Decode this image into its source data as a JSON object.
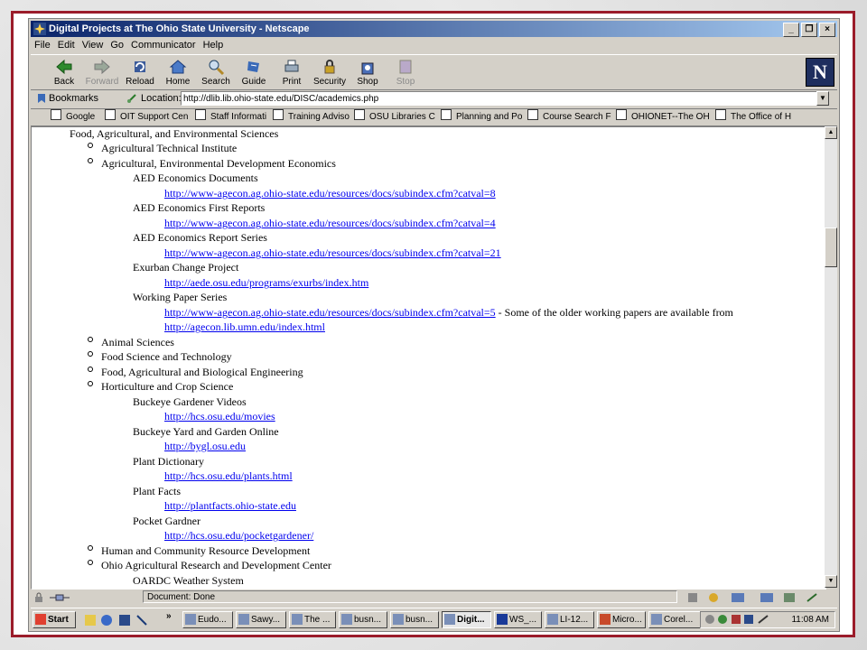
{
  "window": {
    "title": "Digital Projects at The Ohio State University - Netscape"
  },
  "menu": [
    "File",
    "Edit",
    "View",
    "Go",
    "Communicator",
    "Help"
  ],
  "toolbar": {
    "back": "Back",
    "forward": "Forward",
    "reload": "Reload",
    "home": "Home",
    "search": "Search",
    "guide": "Guide",
    "print": "Print",
    "security": "Security",
    "shop": "Shop",
    "stop": "Stop",
    "logo": "N"
  },
  "location": {
    "bookmarks": "Bookmarks",
    "label": "Location:",
    "url": "http://dlib.lib.ohio-state.edu/DISC/academics.php"
  },
  "personal": [
    "Google",
    "OIT Support Cen",
    "Staff Informati",
    "Training Adviso",
    "OSU Libraries C",
    "Planning and Po",
    "Course Search F",
    "OHIONET--The OH",
    "The Office of H"
  ],
  "content": {
    "heading": "Food, Agricultural, and Environmental Sciences",
    "l1": "Agricultural Technical Institute",
    "l2": "Agricultural, Environmental Development Economics",
    "l3": "AED Economics Documents",
    "l4": "http://www-agecon.ag.ohio-state.edu/resources/docs/subindex.cfm?catval=8",
    "l5": "AED Economics First Reports",
    "l6": "http://www-agecon.ag.ohio-state.edu/resources/docs/subindex.cfm?catval=4",
    "l7": "AED Economics Report Series",
    "l8": "http://www-agecon.ag.ohio-state.edu/resources/docs/subindex.cfm?catval=21",
    "l9": "Exurban Change Project",
    "l10": "http://aede.osu.edu/programs/exurbs/index.htm",
    "l11": "Working Paper Series",
    "l12": "http://www-agecon.ag.ohio-state.edu/resources/docs/subindex.cfm?catval=5",
    "l12b": " - Some of the older working papers are available from",
    "l13": "http://agecon.lib.umn.edu/index.html",
    "l14": "Animal Sciences",
    "l15": "Food Science and Technology",
    "l16": "Food, Agricultural and Biological Engineering",
    "l17": "Horticulture and Crop Science",
    "l18": "Buckeye Gardener Videos",
    "l19": "http://hcs.osu.edu/movies",
    "l20": "Buckeye Yard and Garden Online",
    "l21": "http://bygl.osu.edu",
    "l22": "Plant Dictionary",
    "l23": "http://hcs.osu.edu/plants.html",
    "l24": "Plant Facts",
    "l25": "http://plantfacts.ohio-state.edu",
    "l26": "Pocket Gardner",
    "l27": "http://hcs.osu.edu/pocketgardener/",
    "l28": "Human and Community Resource Development",
    "l29": "Ohio Agricultural Research and Development Center",
    "l30": "OARDC Weather System"
  },
  "status": {
    "text": "Document: Done"
  },
  "taskbar": {
    "start": "Start",
    "items": [
      "Eudo...",
      "Sawy...",
      "The ...",
      "busn...",
      "busn...",
      "Digit...",
      "WS_...",
      "LI-12...",
      "Micro...",
      "Corel..."
    ],
    "clock": "11:08 AM"
  }
}
